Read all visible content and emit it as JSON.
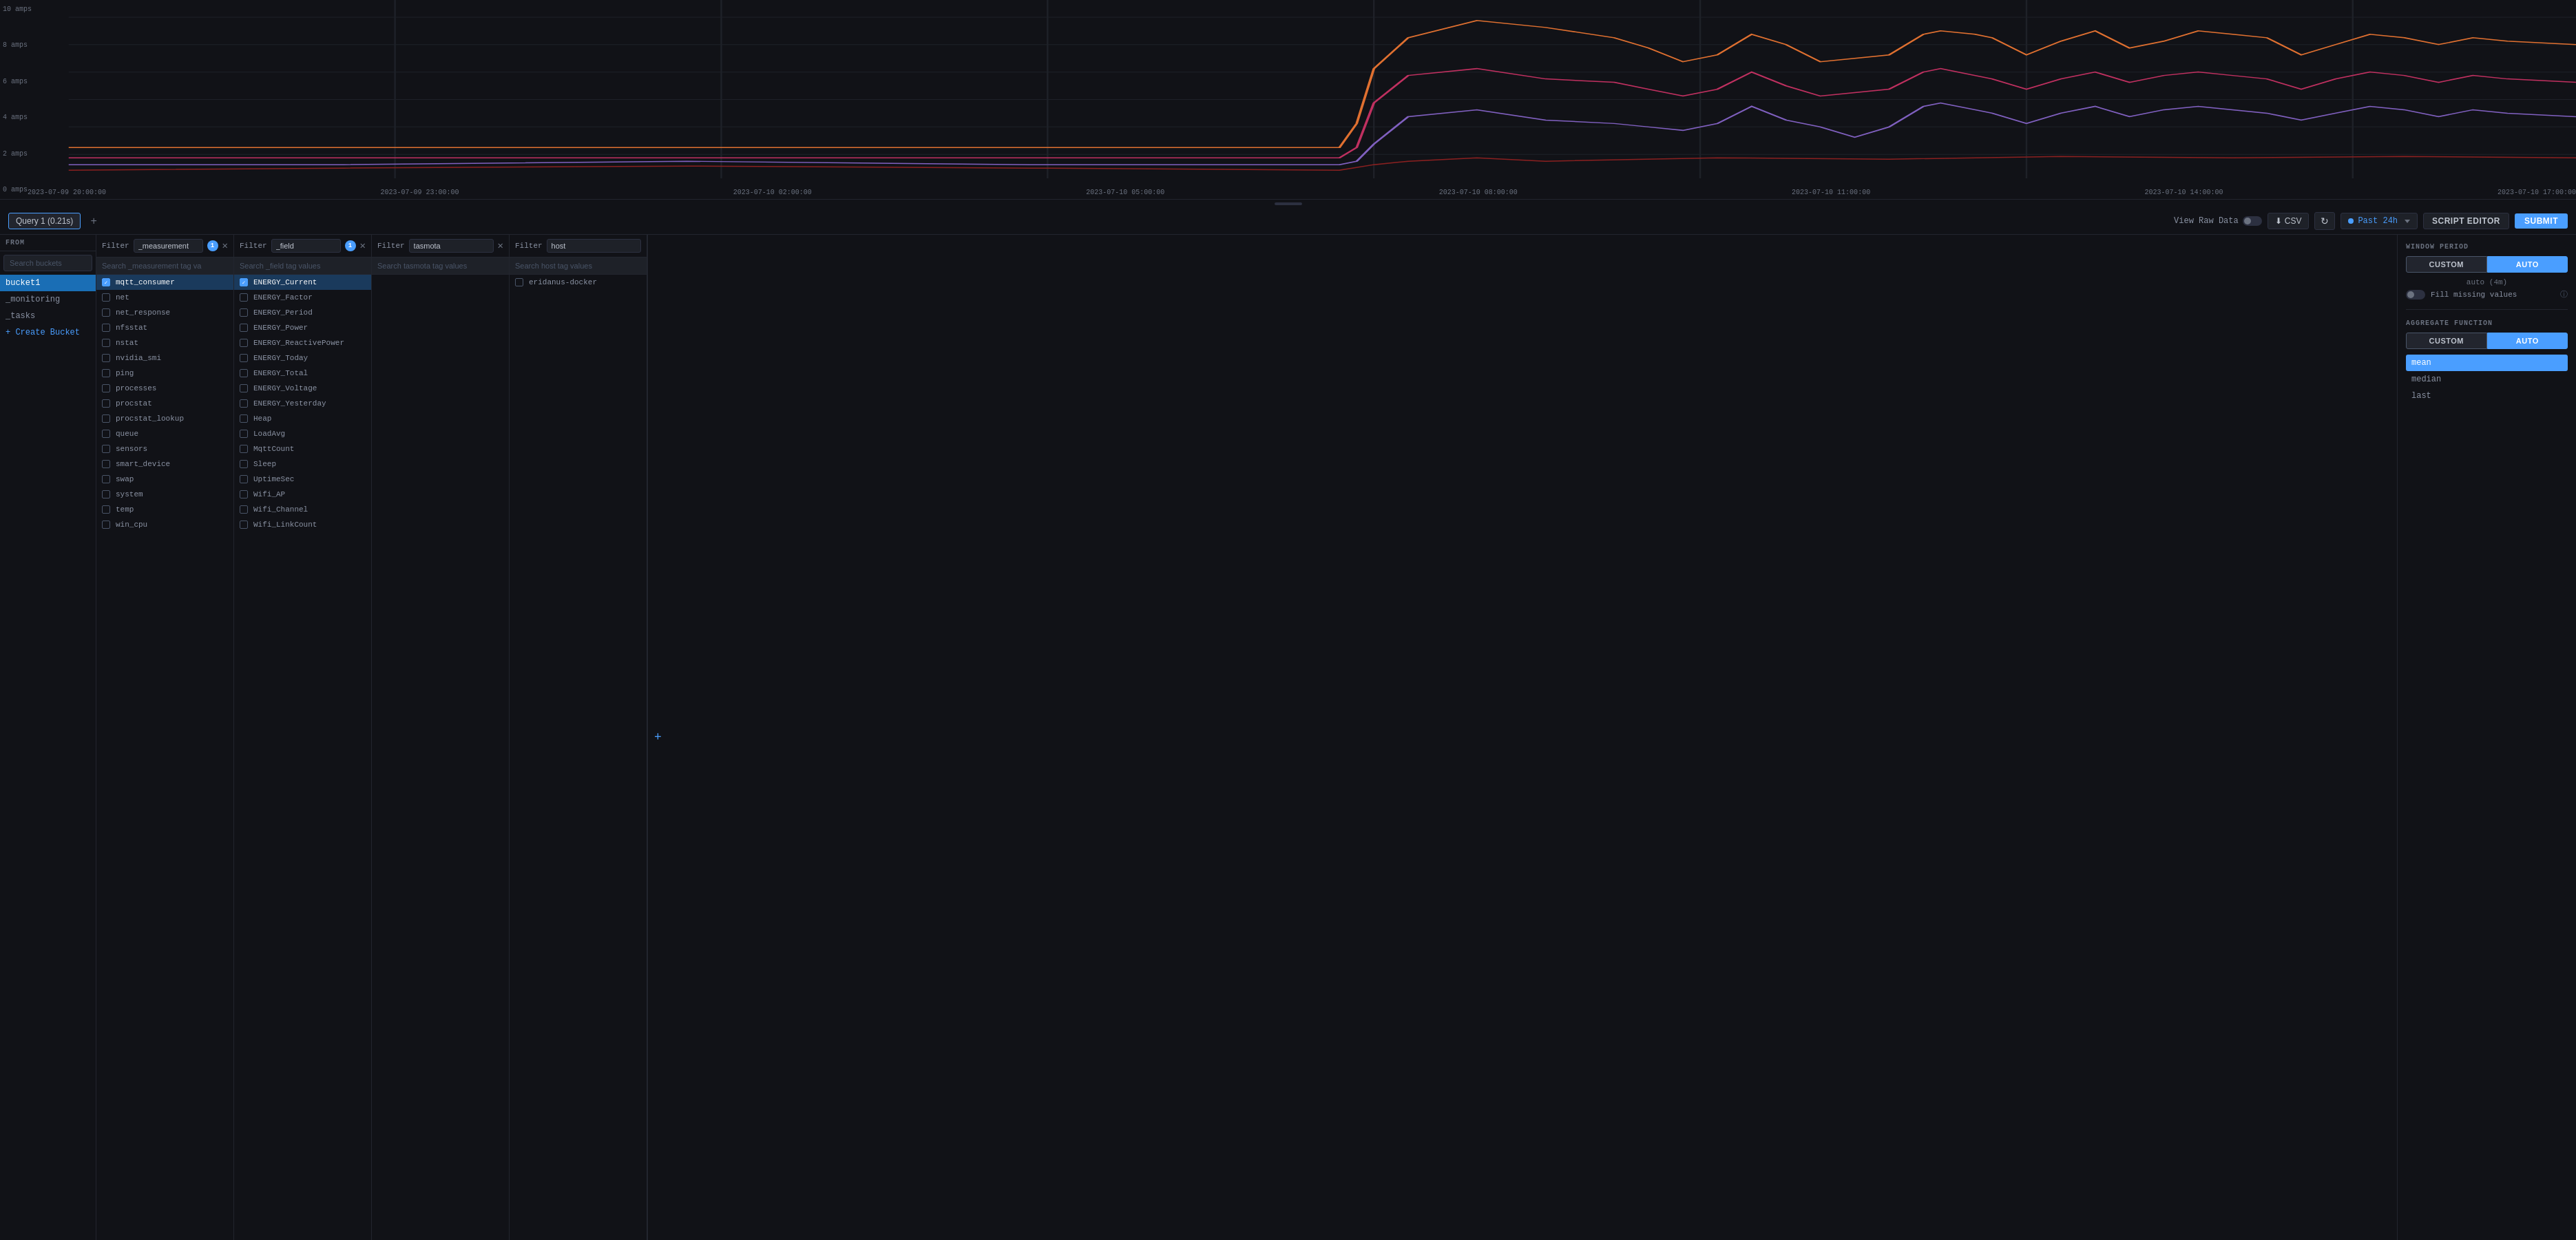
{
  "chart": {
    "y_labels": [
      "10 amps",
      "8 amps",
      "6 amps",
      "4 amps",
      "2 amps",
      "0 amps"
    ],
    "x_labels": [
      "2023-07-09 20:00:00",
      "2023-07-09 23:00:00",
      "2023-07-10 02:00:00",
      "2023-07-10 05:00:00",
      "2023-07-10 08:00:00",
      "2023-07-10 11:00:00",
      "2023-07-10 14:00:00",
      "2023-07-10 17:00:00"
    ]
  },
  "query_bar": {
    "query_tab_label": "Query 1 (0.21s)",
    "add_query_label": "+",
    "view_raw_label": "View Raw Data",
    "csv_label": "CSV",
    "time_range_label": "Past 24h",
    "script_editor_label": "SCRIPT EDITOR",
    "submit_label": "SUBMIT"
  },
  "from_panel": {
    "header": "FROM",
    "search_placeholder": "Search buckets",
    "buckets": [
      {
        "name": "bucket1",
        "active": true
      },
      {
        "name": "_monitoring",
        "active": false
      },
      {
        "name": "_tasks",
        "active": false
      }
    ],
    "create_label": "+ Create Bucket"
  },
  "filter_panels": [
    {
      "id": "measurement",
      "label": "_measurement",
      "badge": "1",
      "search_placeholder": "Search _measurement tag va",
      "has_close": true,
      "items": [
        {
          "name": "mqtt_consumer",
          "selected": true
        },
        {
          "name": "net",
          "selected": false
        },
        {
          "name": "net_response",
          "selected": false
        },
        {
          "name": "nfsstat",
          "selected": false
        },
        {
          "name": "nstat",
          "selected": false
        },
        {
          "name": "nvidia_smi",
          "selected": false
        },
        {
          "name": "ping",
          "selected": false
        },
        {
          "name": "processes",
          "selected": false
        },
        {
          "name": "procstat",
          "selected": false
        },
        {
          "name": "procstat_lookup",
          "selected": false
        },
        {
          "name": "queue",
          "selected": false
        },
        {
          "name": "sensors",
          "selected": false
        },
        {
          "name": "smart_device",
          "selected": false
        },
        {
          "name": "swap",
          "selected": false
        },
        {
          "name": "system",
          "selected": false
        },
        {
          "name": "temp",
          "selected": false
        },
        {
          "name": "win_cpu",
          "selected": false
        }
      ]
    },
    {
      "id": "field",
      "label": "_field",
      "badge": "1",
      "search_placeholder": "Search _field tag values",
      "has_close": true,
      "items": [
        {
          "name": "ENERGY_Current",
          "selected": true
        },
        {
          "name": "ENERGY_Factor",
          "selected": false
        },
        {
          "name": "ENERGY_Period",
          "selected": false
        },
        {
          "name": "ENERGY_Power",
          "selected": false
        },
        {
          "name": "ENERGY_ReactivePower",
          "selected": false
        },
        {
          "name": "ENERGY_Today",
          "selected": false
        },
        {
          "name": "ENERGY_Total",
          "selected": false
        },
        {
          "name": "ENERGY_Voltage",
          "selected": false
        },
        {
          "name": "ENERGY_Yesterday",
          "selected": false
        },
        {
          "name": "Heap",
          "selected": false
        },
        {
          "name": "LoadAvg",
          "selected": false
        },
        {
          "name": "MqttCount",
          "selected": false
        },
        {
          "name": "Sleep",
          "selected": false
        },
        {
          "name": "UptimeSec",
          "selected": false
        },
        {
          "name": "Wifi_AP",
          "selected": false
        },
        {
          "name": "Wifi_Channel",
          "selected": false
        },
        {
          "name": "Wifi_LinkCount",
          "selected": false
        }
      ]
    },
    {
      "id": "tasmota",
      "label": "tasmota",
      "badge": null,
      "search_placeholder": "Search tasmota tag values",
      "has_close": true,
      "items": []
    },
    {
      "id": "host",
      "label": "host",
      "badge": null,
      "search_placeholder": "Search host tag values",
      "has_close": false,
      "items": [
        {
          "name": "eridanus-docker",
          "selected": false
        }
      ]
    }
  ],
  "right_sidebar": {
    "window_period_title": "WINDOW PERIOD",
    "custom_label": "CUSTOM",
    "auto_label": "AUTO",
    "auto_value": "auto (4m)",
    "fill_missing_label": "Fill missing values",
    "aggregate_function_title": "AGGREGATE FUNCTION",
    "agg_custom_label": "CUSTOM",
    "agg_auto_label": "AUTO",
    "agg_items": [
      {
        "name": "mean",
        "active": true
      },
      {
        "name": "median",
        "active": false
      },
      {
        "name": "last",
        "active": false
      }
    ]
  }
}
